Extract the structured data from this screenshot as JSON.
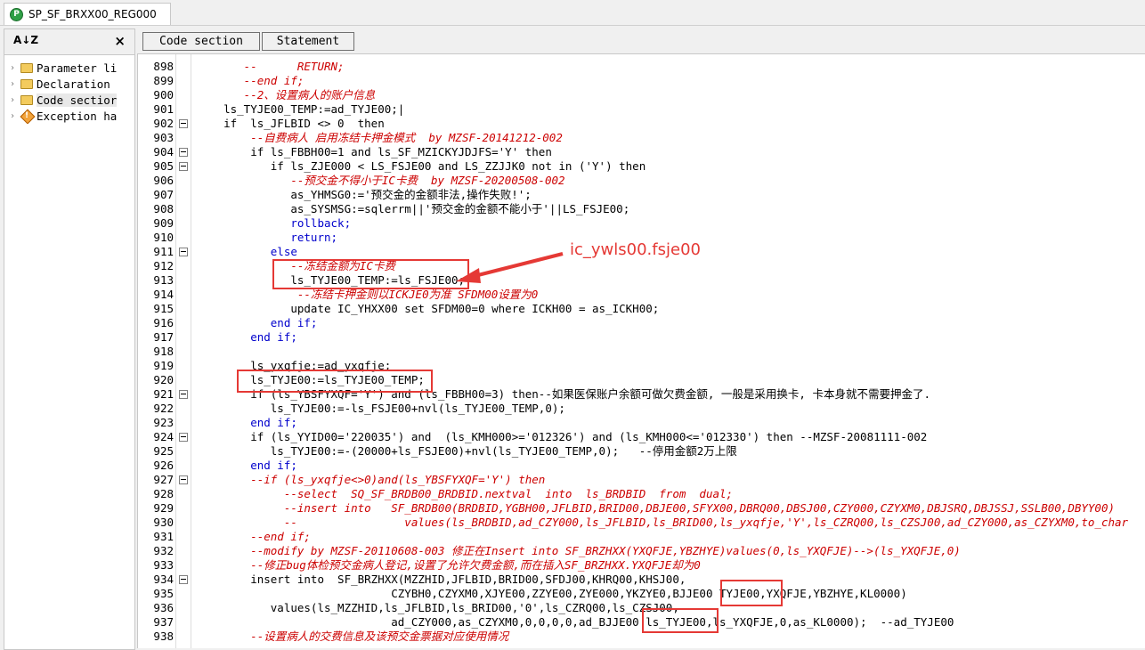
{
  "tab": {
    "title": "SP_SF_BRXX00_REG000"
  },
  "left_panel": {
    "items": [
      {
        "label": "Parameter li",
        "icon": "folder-icon"
      },
      {
        "label": "Declaration",
        "icon": "folder-icon"
      },
      {
        "label": "Code sectior",
        "icon": "folder-icon"
      },
      {
        "label": "Exception ha",
        "icon": "exception-icon"
      }
    ]
  },
  "toolbar": {
    "code_section": "Code section",
    "statement": "Statement"
  },
  "annotation": {
    "text": "ic_ywls00.fsje00"
  },
  "editor": {
    "lines": [
      {
        "n": "898",
        "fold": false,
        "code": "       --      RETURN;",
        "cls": "c"
      },
      {
        "n": "899",
        "fold": false,
        "code": "       --end if;",
        "cls": "c"
      },
      {
        "n": "900",
        "fold": false,
        "code": "       --2、设置病人的账户信息",
        "cls": "c"
      },
      {
        "n": "901",
        "fold": false,
        "code": "    ls_TYJE00_TEMP:=ad_TYJE00;|",
        "cls": ""
      },
      {
        "n": "902",
        "fold": true,
        "code": "    if  ls_JFLBID <> 0  then",
        "cls": ""
      },
      {
        "n": "903",
        "fold": false,
        "code": "        --自费病人 启用冻结卡押金模式  by MZSF-20141212-002",
        "cls": "c"
      },
      {
        "n": "904",
        "fold": true,
        "code": "        if ls_FBBH00=1 and ls_SF_MZICKYJDJFS='Y' then",
        "cls": ""
      },
      {
        "n": "905",
        "fold": true,
        "code": "           if ls_ZJE000 < LS_FSJE00 and LS_ZZJJK0 not in ('Y') then",
        "cls": ""
      },
      {
        "n": "906",
        "fold": false,
        "code": "              --预交金不得小于IC卡费  by MZSF-20200508-002",
        "cls": "c"
      },
      {
        "n": "907",
        "fold": false,
        "code": "              as_YHMSG0:='预交金的金额非法,操作失败!';",
        "cls": ""
      },
      {
        "n": "908",
        "fold": false,
        "code": "              as_SYSMSG:=sqlerrm||'预交金的金额不能小于'||LS_FSJE00;",
        "cls": ""
      },
      {
        "n": "909",
        "fold": false,
        "code": "              rollback;",
        "cls": "k"
      },
      {
        "n": "910",
        "fold": false,
        "code": "              return;",
        "cls": "k"
      },
      {
        "n": "911",
        "fold": true,
        "code": "           else",
        "cls": "k"
      },
      {
        "n": "912",
        "fold": false,
        "code": "              --冻结金额为IC卡费",
        "cls": "c"
      },
      {
        "n": "913",
        "fold": false,
        "code": "              ls_TYJE00_TEMP:=ls_FSJE00;",
        "cls": ""
      },
      {
        "n": "914",
        "fold": false,
        "code": "               --冻结卡押金则以ICKJE0为准 SFDM00设置为0",
        "cls": "c"
      },
      {
        "n": "915",
        "fold": false,
        "code": "              update IC_YHXX00 set SFDM00=0 where ICKH00 = as_ICKH00;",
        "cls": ""
      },
      {
        "n": "916",
        "fold": false,
        "code": "           end if;",
        "cls": "k"
      },
      {
        "n": "917",
        "fold": false,
        "code": "        end if;",
        "cls": "k"
      },
      {
        "n": "918",
        "fold": false,
        "code": "",
        "cls": ""
      },
      {
        "n": "919",
        "fold": false,
        "code": "        ls_yxqfje:=ad_yxqfje;",
        "cls": ""
      },
      {
        "n": "920",
        "fold": false,
        "code": "        ls_TYJE00:=ls_TYJE00_TEMP;",
        "cls": ""
      },
      {
        "n": "921",
        "fold": true,
        "code": "        if (ls_YBSFYXQF='Y') and (ls_FBBH00=3) then--如果医保账户余额可做欠费金额, 一般是采用换卡, 卡本身就不需要押金了.",
        "cls": ""
      },
      {
        "n": "922",
        "fold": false,
        "code": "           ls_TYJE00:=-ls_FSJE00+nvl(ls_TYJE00_TEMP,0);",
        "cls": ""
      },
      {
        "n": "923",
        "fold": false,
        "code": "        end if;",
        "cls": "k"
      },
      {
        "n": "924",
        "fold": true,
        "code": "        if (ls_YYID00='220035') and  (ls_KMH000>='012326') and (ls_KMH000<='012330') then --MZSF-20081111-002",
        "cls": ""
      },
      {
        "n": "925",
        "fold": false,
        "code": "           ls_TYJE00:=-(20000+ls_FSJE00)+nvl(ls_TYJE00_TEMP,0);   --停用金额2万上限",
        "cls": ""
      },
      {
        "n": "926",
        "fold": false,
        "code": "        end if;",
        "cls": "k"
      },
      {
        "n": "927",
        "fold": true,
        "code": "        --if (ls_yxqfje<>0)and(ls_YBSFYXQF='Y') then",
        "cls": "c"
      },
      {
        "n": "928",
        "fold": false,
        "code": "             --select  SQ_SF_BRDB00_BRDBID.nextval  into  ls_BRDBID  from  dual;",
        "cls": "c"
      },
      {
        "n": "929",
        "fold": false,
        "code": "             --insert into   SF_BRDB00(BRDBID,YGBH00,JFLBID,BRID00,DBJE00,SFYX00,DBRQ00,DBSJ00,CZY000,CZYXM0,DBJSRQ,DBJSSJ,SSLB00,DBYY00)",
        "cls": "c"
      },
      {
        "n": "930",
        "fold": false,
        "code": "             --                values(ls_BRDBID,ad_CZY000,ls_JFLBID,ls_BRID00,ls_yxqfje,'Y',ls_CZRQ00,ls_CZSJ00,ad_CZY000,as_CZYXM0,to_char",
        "cls": "c"
      },
      {
        "n": "931",
        "fold": false,
        "code": "        --end if;",
        "cls": "c"
      },
      {
        "n": "932",
        "fold": false,
        "code": "        --modify by MZSF-20110608-003 修正在Insert into SF_BRZHXX(YXQFJE,YBZHYE)values(0,ls_YXQFJE)-->(ls_YXQFJE,0)",
        "cls": "c"
      },
      {
        "n": "933",
        "fold": false,
        "code": "        --修正bug体检预交金病人登记,设置了允许欠费金额,而在插入SF_BRZHXX.YXQFJE却为0",
        "cls": "c"
      },
      {
        "n": "934",
        "fold": true,
        "code": "        insert into  SF_BRZHXX(MZZHID,JFLBID,BRID00,SFDJ00,KHRQ00,KHSJ00,",
        "cls": ""
      },
      {
        "n": "935",
        "fold": false,
        "code": "                             CZYBH0,CZYXM0,XJYE00,ZZYE00,ZYE000,YKZYE0,BJJE00 TYJE00,YXQFJE,YBZHYE,KL0000)",
        "cls": ""
      },
      {
        "n": "936",
        "fold": false,
        "code": "           values(ls_MZZHID,ls_JFLBID,ls_BRID00,'0',ls_CZRQ00,ls_CZSJ00,",
        "cls": ""
      },
      {
        "n": "937",
        "fold": false,
        "code": "                             ad_CZY000,as_CZYXM0,0,0,0,0,ad_BJJE00 ls_TYJE00,ls_YXQFJE,0,as_KL0000);  --ad_TYJE00",
        "cls": ""
      },
      {
        "n": "938",
        "fold": false,
        "code": "        --设置病人的交费信息及该预交金票据对应使用情况",
        "cls": "c"
      }
    ]
  }
}
